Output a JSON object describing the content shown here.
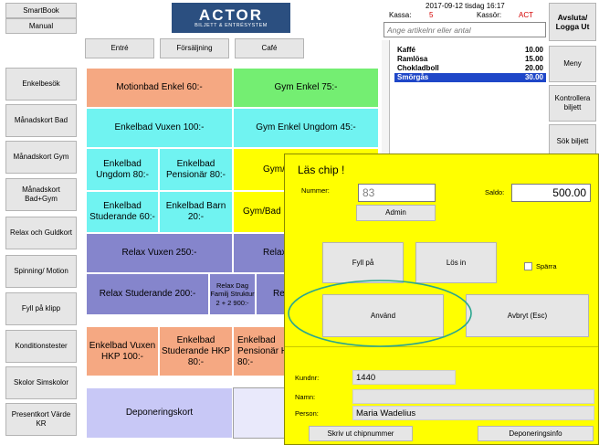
{
  "left_top": {
    "smartbook": "SmartBook",
    "manual": "Manual"
  },
  "logo": {
    "title": "ACTOR",
    "subtitle": "BILJETT & ENTRÉSYSTEM"
  },
  "tabs": [
    "Entré",
    "Försäljning",
    "Café"
  ],
  "sidebar": [
    "Enkelbesök",
    "Månadskort Bad",
    "Månadskort Gym",
    "Månadskort Bad+Gym",
    "Relax och Guldkort",
    "Spinning/ Motion",
    "Fyll på klipp",
    "Konditionstester",
    "Skolor Simskolor",
    "Presentkort Värde KR"
  ],
  "tiles": {
    "motionbad": "Motionbad Enkel 60:-",
    "gym_enkel": "Gym Enkel 75:-",
    "enkelbad_vuxen": "Enkelbad Vuxen 100:-",
    "gym_ungdom": "Gym Enkel Ungdom 45:-",
    "enkelbad_ungdom": "Enkelbad Ungdom 80:-",
    "enkelbad_pensionar": "Enkelbad Pensionär 80:-",
    "gym_partial1": "Gym/",
    "enkelbad_studerande": "Enkelbad Studerande 60:-",
    "enkelbad_barn": "Enkelbad Barn 20:-",
    "gym_partial2": "Gym/Bad",
    "relax_vuxen": "Relax Vuxen 250:-",
    "relax_partial1": "Relax",
    "relax_studerande": "Relax Studerande 200:-",
    "relax_dag": "Relax Dag Familj Struktur 2 + 2 900:-",
    "relax_partial2": "Re",
    "enkelbad_vuxen_hkp": "Enkelbad Vuxen HKP 100:-",
    "enkelbad_studerande_hkp": "Enkelbad Studerande HKP 80:-",
    "enkelbad_pensionar_hkp": "Enkelbad Pensionär HKP 80:-",
    "deponeringskort": "Deponeringskort"
  },
  "header_info": {
    "datetime": "2017-09-12 tisdag 16:17",
    "kassa_label": "Kassa:",
    "kassa_value": "5",
    "kassor_label": "Kassör:",
    "kassor_value": "ACT"
  },
  "search": {
    "placeholder": "Ange artikelnr eller antal"
  },
  "cart": [
    {
      "name": "Kaffé",
      "price": "10.00"
    },
    {
      "name": "Ramlösa",
      "price": "15.00"
    },
    {
      "name": "Chokladboll",
      "price": "20.00"
    },
    {
      "name": "Smörgås",
      "price": "30.00"
    }
  ],
  "right_buttons": [
    "Avsluta/ Logga Ut",
    "Meny",
    "Kontrollera biljett",
    "Sök biljett"
  ],
  "dialog": {
    "title": "Läs chip !",
    "nummer_label": "Nummer:",
    "nummer_value": "83",
    "saldo_label": "Saldo:",
    "saldo_value": "500.00",
    "admin": "Admin",
    "fyll_pa": "Fyll på",
    "los_in": "Lös in",
    "sparra": "Spärra",
    "anvand": "Använd",
    "avbryt": "Avbryt (Esc)",
    "kundnr_label": "Kundnr:",
    "kundnr_value": "1440",
    "namn_label": "Namn:",
    "namn_value": "",
    "person_label": "Person:",
    "person_value": "Maria Wadelius",
    "skriv_ut": "Skriv ut chipnummer",
    "deponeringsinfo": "Deponeringsinfo"
  },
  "colors": {
    "dialog_bg": "#ffff00",
    "highlight_ellipse": "#2aa68f",
    "accent_red": "#d40000",
    "selected_row": "#1f47c8"
  }
}
